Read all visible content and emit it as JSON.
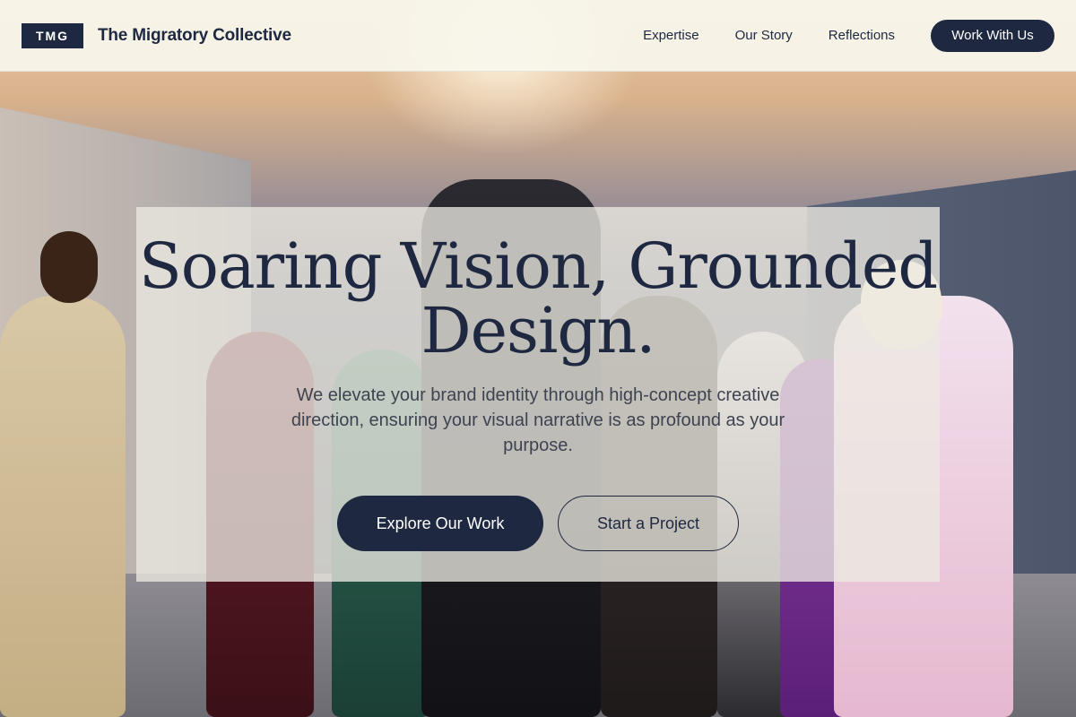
{
  "header": {
    "logo_text": "TMG",
    "brand_name": "The Migratory Collective",
    "nav": [
      {
        "label": "Expertise"
      },
      {
        "label": "Our Story"
      },
      {
        "label": "Reflections"
      }
    ],
    "cta_label": "Work With Us"
  },
  "hero": {
    "title_line1": "Soaring Vision, Grounded",
    "title_line2": "Design.",
    "subtitle": "We elevate your brand identity through high-concept creative direction, ensuring your visual narrative is as profound as your purpose.",
    "primary_button": "Explore Our Work",
    "secondary_button": "Start a Project"
  },
  "colors": {
    "brand_navy": "#1e2840",
    "header_background": "#f8f6ec",
    "button_text": "#ffffff"
  }
}
